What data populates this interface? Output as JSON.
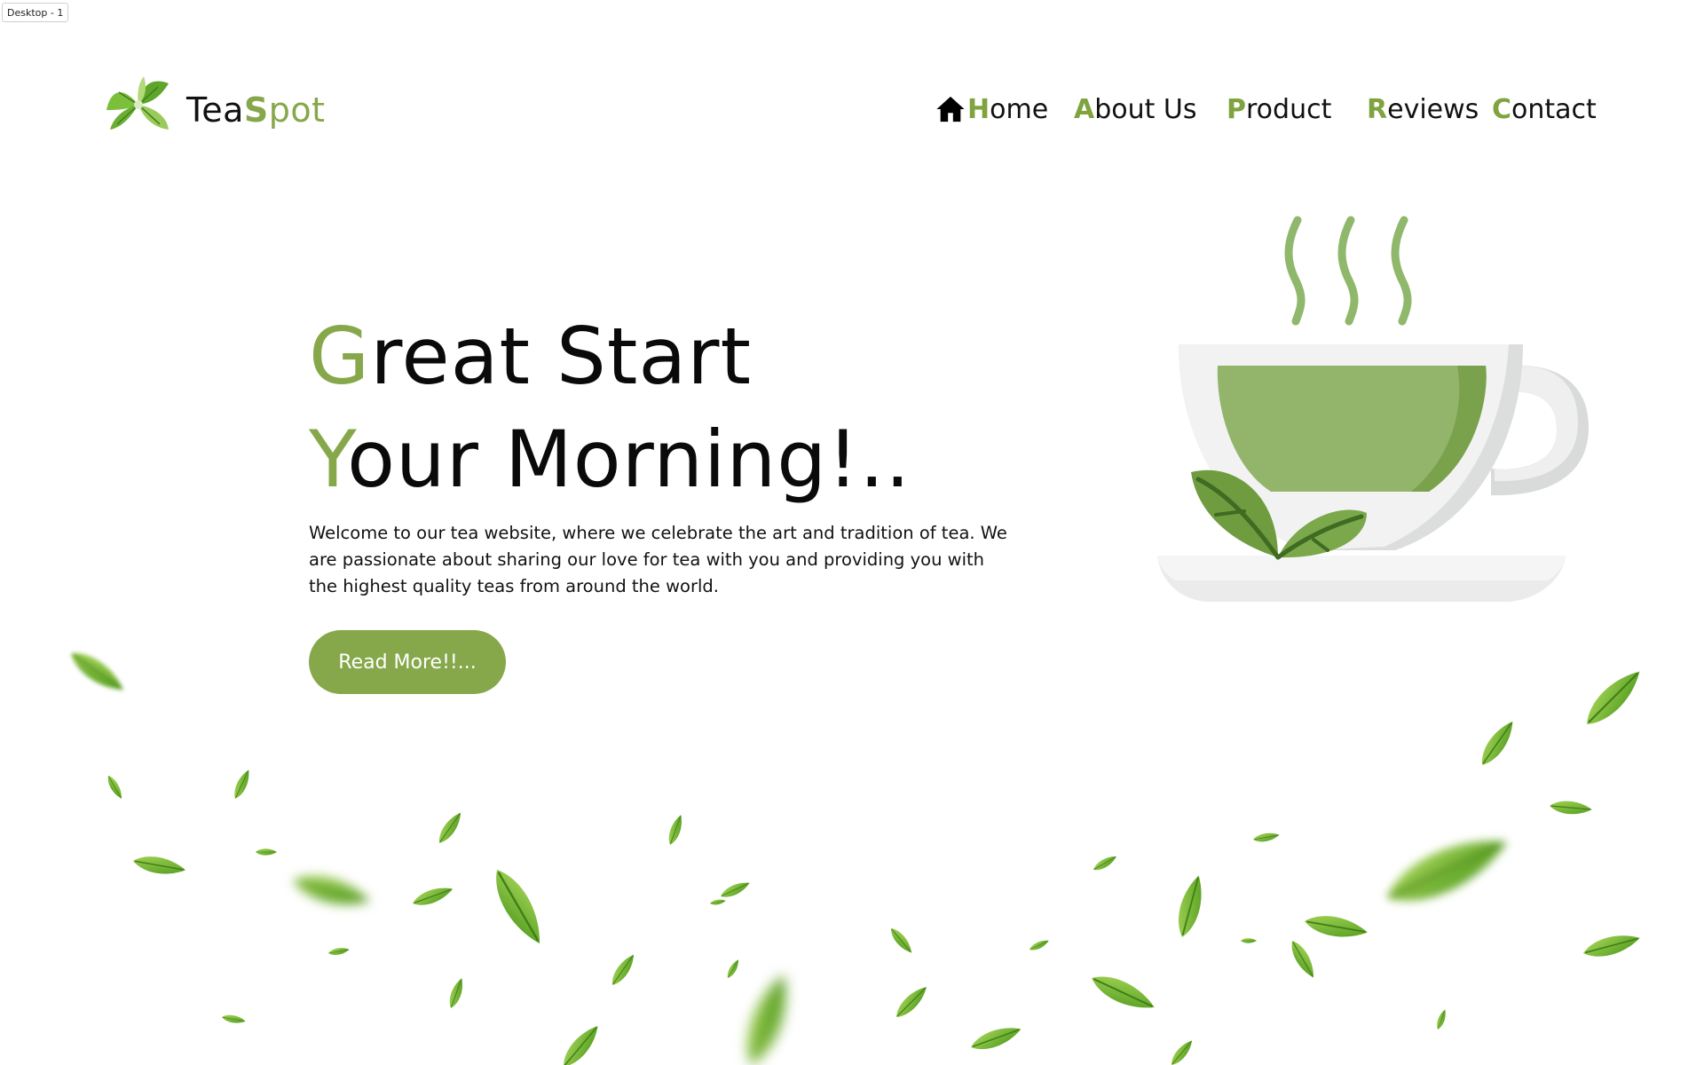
{
  "canvas": {
    "frame_label": "Desktop - 1"
  },
  "colors": {
    "accent": "#86a84b",
    "text": "#0a0a0a",
    "button_text": "#ffffff",
    "cup_liquid": "#93b56b",
    "cup_body": "#f1f2f1",
    "steam": "#8fb86c"
  },
  "header": {
    "logo_icon": "tea-leaves-logo-icon",
    "brand": {
      "part1": "Tea",
      "accent_letter": "S",
      "accent_rest": "pot"
    },
    "nav": [
      {
        "id": "home",
        "icon": "home-icon",
        "first": "H",
        "rest": "ome"
      },
      {
        "id": "about",
        "first": "A",
        "rest": "bout Us"
      },
      {
        "id": "product",
        "first": "P",
        "rest": "roduct"
      },
      {
        "id": "reviews",
        "first": "R",
        "rest": "eviews"
      },
      {
        "id": "contact",
        "first": "C",
        "rest": "ontact"
      }
    ]
  },
  "hero": {
    "title_line1": {
      "first": "G",
      "rest": "reat Start"
    },
    "title_line2": {
      "first": "Y",
      "rest": "our Morning!.."
    },
    "description": "Welcome to our tea website, where we celebrate the art and tradition of tea. We are passionate about sharing our love for tea with you and providing you with the highest quality teas from around the world.",
    "button_label": "Read More!!...",
    "illustration_icon": "tea-cup-icon",
    "decoration_icon": "flying-leaves-icon"
  }
}
